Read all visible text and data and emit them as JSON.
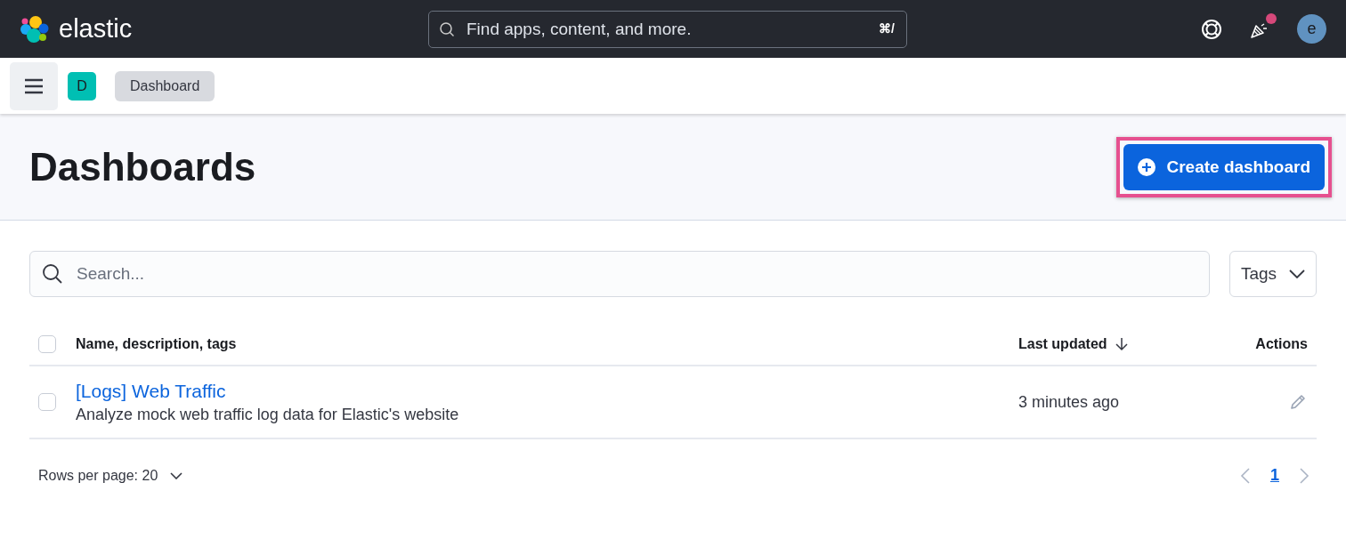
{
  "header": {
    "logo_text": "elastic",
    "search": {
      "placeholder": "Find apps, content, and more.",
      "shortcut": "⌘/"
    },
    "notification_unread": true,
    "avatar_initial": "e"
  },
  "subheader": {
    "space_initial": "D",
    "breadcrumb": "Dashboard"
  },
  "page": {
    "title": "Dashboards",
    "create_button": {
      "label": "Create dashboard",
      "highlighted": true
    }
  },
  "filters": {
    "search": {
      "placeholder": "Search..."
    },
    "tags_button": "Tags"
  },
  "table": {
    "columns": [
      {
        "label": "Name, description, tags",
        "sorted": false
      },
      {
        "label": "Last updated",
        "sorted": true
      },
      {
        "label": "Actions",
        "sorted": false
      }
    ],
    "header_checked": false,
    "rows": [
      {
        "title": "[Logs] Web Traffic",
        "description": "Analyze mock web traffic log data for Elastic's website",
        "updated": "3 minutes ago",
        "checked": false
      }
    ]
  },
  "pagination": {
    "rows_per_page": "Rows per page: 20",
    "pages": [
      {
        "label": "1",
        "selected": true
      }
    ]
  }
}
